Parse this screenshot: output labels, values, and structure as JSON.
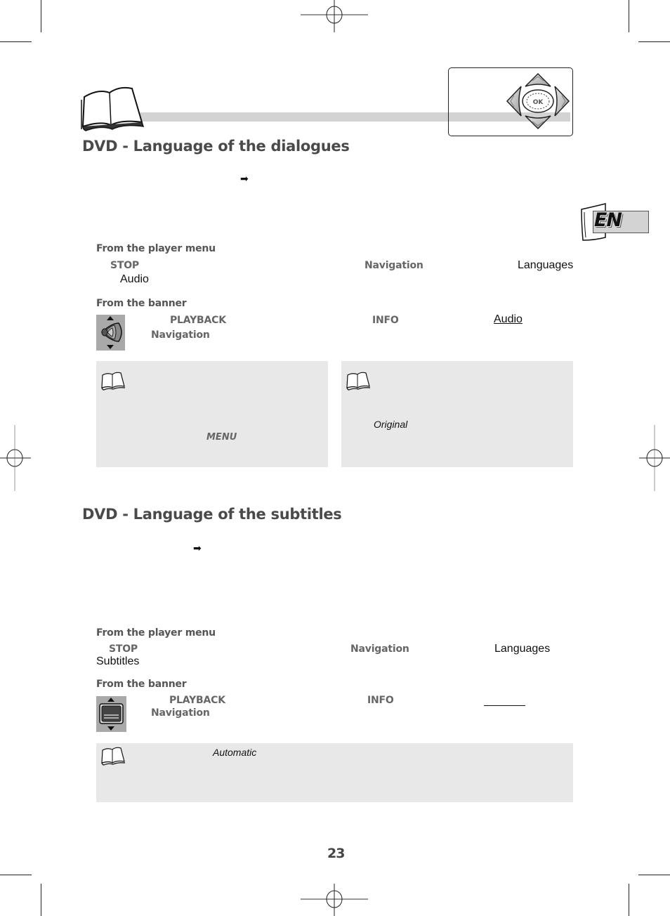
{
  "page": {
    "number": "23",
    "language_tab": "EN"
  },
  "icons": {
    "manual": "open-book-icon",
    "navigation_pad": "dpad-ok-icon",
    "arrow": "right-arrow-icon",
    "audio": "audio-speaker-icon",
    "subtitles": "subtitles-screen-icon",
    "note": "open-book-icon"
  },
  "navigation_pad": {
    "center_label": "OK"
  },
  "colors": {
    "title_gray": "#4a4a4a",
    "keyword_gray": "#666666",
    "note_background": "#e8e8e8",
    "header_bar": "#d3d3d3"
  },
  "dialogues_section": {
    "title": "DVD - Language of the dialogues",
    "arrow": "➡",
    "from_player_menu": {
      "heading": "From the player menu",
      "key_stop": "STOP",
      "key_navigation": "Navigation",
      "menu_languages": "Languages",
      "menu_audio": "Audio"
    },
    "from_banner": {
      "heading": "From the banner",
      "key_playback": "PLAYBACK",
      "key_info": "INFO",
      "banner_item": "Audio",
      "key_navigation": "Navigation"
    },
    "note_left": {
      "keyword": "MENU"
    },
    "note_right": {
      "keyword": "Original"
    }
  },
  "subtitles_section": {
    "title": "DVD - Language of the subtitles",
    "arrow": "➡",
    "from_player_menu": {
      "heading": "From the player menu",
      "key_stop": "STOP",
      "key_navigation": "Navigation",
      "menu_languages": "Languages",
      "menu_subtitles": "Subtitles"
    },
    "from_banner": {
      "heading": "From the banner",
      "key_playback": "PLAYBACK",
      "key_info": "INFO",
      "key_navigation": "Navigation"
    },
    "note": {
      "keyword": "Automatic"
    }
  }
}
